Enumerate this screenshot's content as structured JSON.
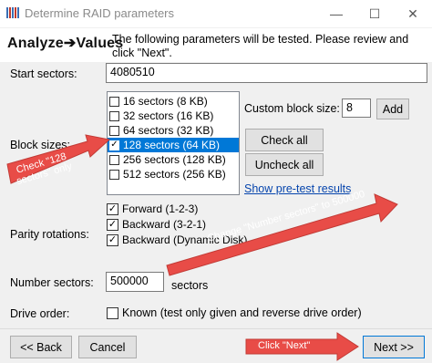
{
  "window": {
    "title": "Determine RAID parameters",
    "minimize_glyph": "—",
    "maximize_glyph": "☐",
    "close_glyph": "✕"
  },
  "header": {
    "logo_text": "Analyze➔Values",
    "info_text": "The following parameters will be tested. Please review and click \"Next\"."
  },
  "start_sectors": {
    "label": "Start sectors:",
    "value": "4080510"
  },
  "block_sizes": {
    "label": "Block sizes:",
    "items": [
      {
        "label": "16 sectors (8 KB)",
        "checked": false,
        "selected": false
      },
      {
        "label": "32 sectors (16 KB)",
        "checked": false,
        "selected": false
      },
      {
        "label": "64 sectors (32 KB)",
        "checked": false,
        "selected": false
      },
      {
        "label": "128 sectors (64 KB)",
        "checked": true,
        "selected": true
      },
      {
        "label": "256 sectors (128 KB)",
        "checked": false,
        "selected": false
      },
      {
        "label": "512 sectors (256 KB)",
        "checked": false,
        "selected": false
      }
    ],
    "custom_label": "Custom block size:",
    "custom_value": "8",
    "add_button": "Add",
    "check_all_button": "Check all",
    "uncheck_all_button": "Uncheck all",
    "pretest_link": "Show pre-test results"
  },
  "parity": {
    "label": "Parity rotations:",
    "options": [
      {
        "label": "Forward (1-2-3)",
        "checked": true
      },
      {
        "label": "Backward (3-2-1)",
        "checked": true
      },
      {
        "label": "Backward (Dynamic Disk)",
        "checked": true
      }
    ]
  },
  "number_sectors": {
    "label": "Number sectors:",
    "value": "500000",
    "suffix": "sectors"
  },
  "drive_order": {
    "label": "Drive order:",
    "option_label": "Known (test only given and reverse drive order)",
    "checked": false
  },
  "footer": {
    "back_button": "<< Back",
    "cancel_button": "Cancel",
    "next_button": "Next >>"
  },
  "annotations": {
    "check128": "Check \"128 sectors\" only",
    "number_sectors": "Change \"Number sectors\" to 500000",
    "next": "Click \"Next\""
  },
  "colors": {
    "selection": "#0078d7",
    "arrow": "#e84c47",
    "link": "#0645ad"
  }
}
